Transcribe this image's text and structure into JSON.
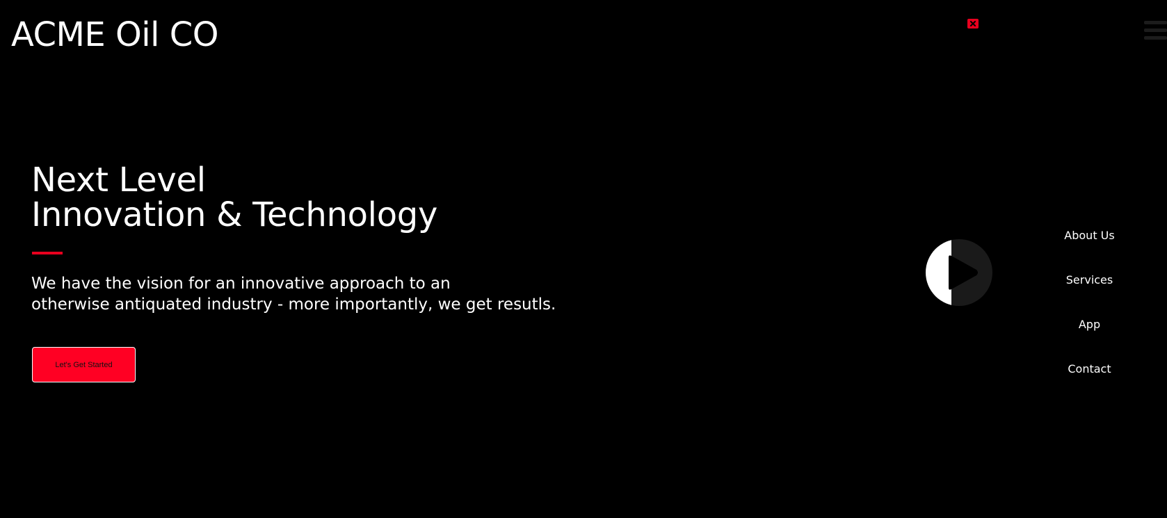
{
  "header": {
    "logo_text": "ACME Oil CO",
    "close_icon": "close-icon",
    "menu_icon": "hamburger-menu-icon"
  },
  "hero": {
    "title_line1": "Next Level",
    "title_line2": "Innovation & Technology",
    "subtitle_line1": "We have the vision for an innovative approach to an",
    "subtitle_line2": "otherwise antiquated industry - more importantly, we get resutls.",
    "cta_label": "Let's Get Started"
  },
  "video": {
    "play_icon": "play-icon"
  },
  "nav": {
    "items": [
      {
        "label": "About Us"
      },
      {
        "label": "Services"
      },
      {
        "label": "App"
      },
      {
        "label": "Contact"
      }
    ]
  },
  "colors": {
    "background": "#000000",
    "accent": "#e8001e",
    "cta_background": "#ff0023",
    "text": "#ffffff",
    "play_dark_half": "#1a1a1a"
  }
}
